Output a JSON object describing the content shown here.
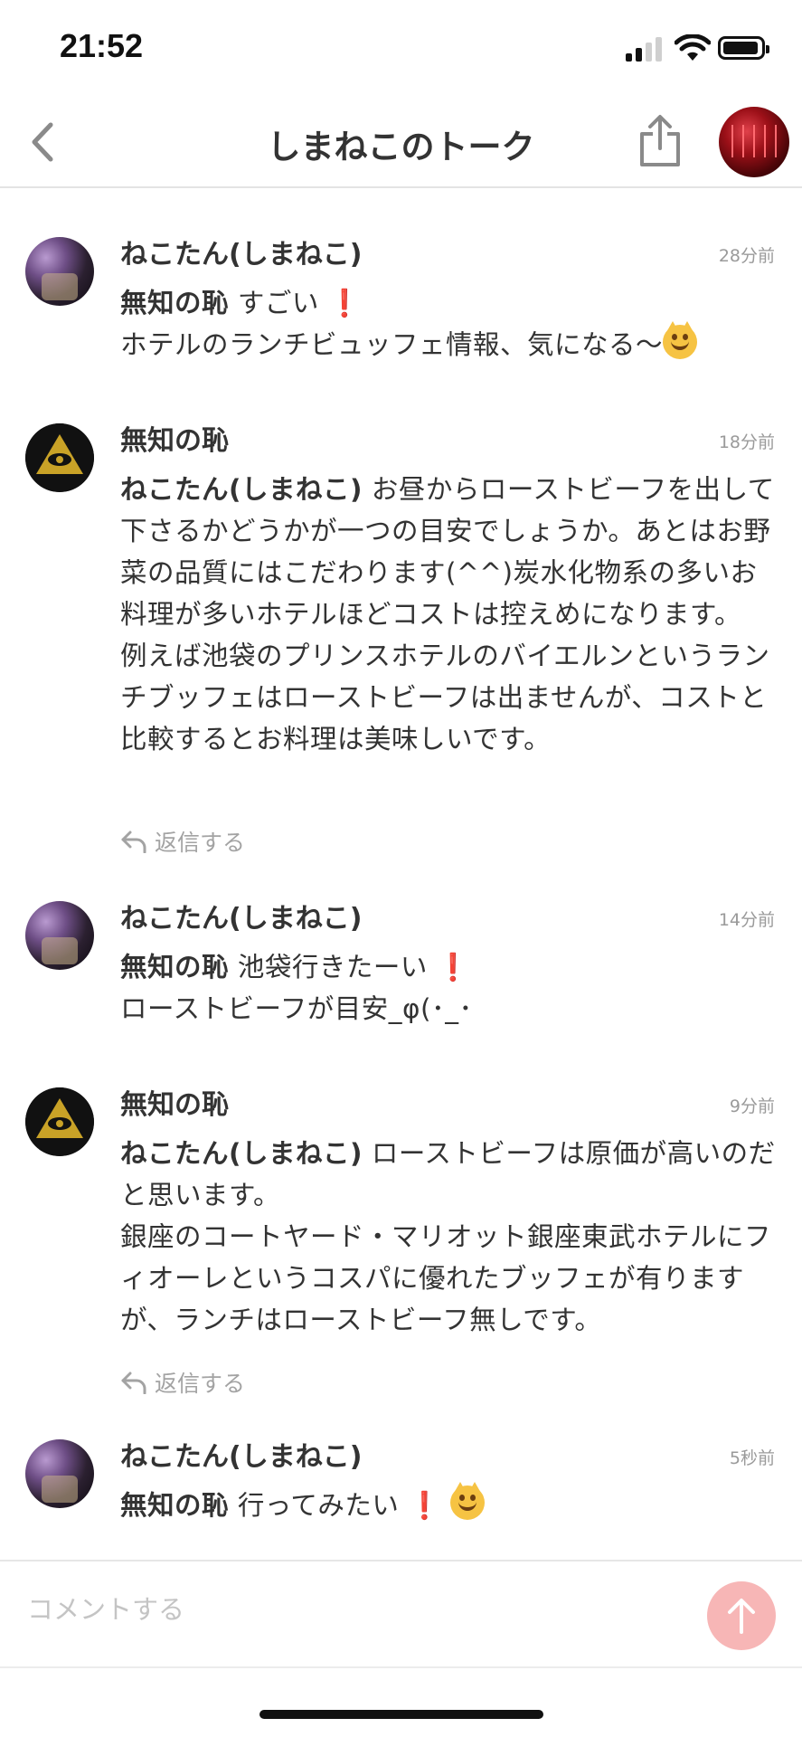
{
  "status": {
    "time": "21:52"
  },
  "header": {
    "title": "しまねこのトーク"
  },
  "messages": [
    {
      "name": "ねこたん(しまねこ)",
      "stamp": "28分前",
      "to": "無知の恥",
      "lines": [
        "すごい",
        "ホテルのランチビュッフェ情報、気になる〜"
      ]
    },
    {
      "name": "無知の恥",
      "stamp": "18分前",
      "to": "ねこたん(しまねこ)",
      "text": "お昼からローストビーフを出して下さるかどうかが一つの目安でしょうか。あとはお野菜の品質にはこだわります(^^)炭水化物系の多いお料理が多いホテルほどコストは控えめになります。",
      "text2": "例えば池袋のプリンスホテルのバイエルンというランチブッフェはローストビーフは出ませんが、コストと比較するとお料理は美味しいです。",
      "reply": "返信する"
    },
    {
      "name": "ねこたん(しまねこ)",
      "stamp": "14分前",
      "to": "無知の恥",
      "lines": [
        "池袋行きたーい",
        "ローストビーフが目安_φ(･_･"
      ]
    },
    {
      "name": "無知の恥",
      "stamp": "9分前",
      "to": "ねこたん(しまねこ)",
      "text": "ローストビーフは原価が高いのだと思います。",
      "text2": "銀座のコートヤード・マリオット銀座東武ホテルにフィオーレというコスパに優れたブッフェが有りますが、ランチはローストビーフ無しです。",
      "reply": "返信する"
    },
    {
      "name": "ねこたん(しまねこ)",
      "stamp": "5秒前",
      "to": "無知の恥",
      "lines": [
        "行ってみたい"
      ]
    }
  ],
  "composer": {
    "placeholder": "コメントする"
  },
  "colors": {
    "accent": "#e0211b",
    "send": "#f7b6b6"
  },
  "icons": [
    "back-chevron-icon",
    "share-icon",
    "reply-arrow-icon",
    "send-arrow-icon",
    "exclamation-icon",
    "smiling-cat-emoji-icon"
  ]
}
